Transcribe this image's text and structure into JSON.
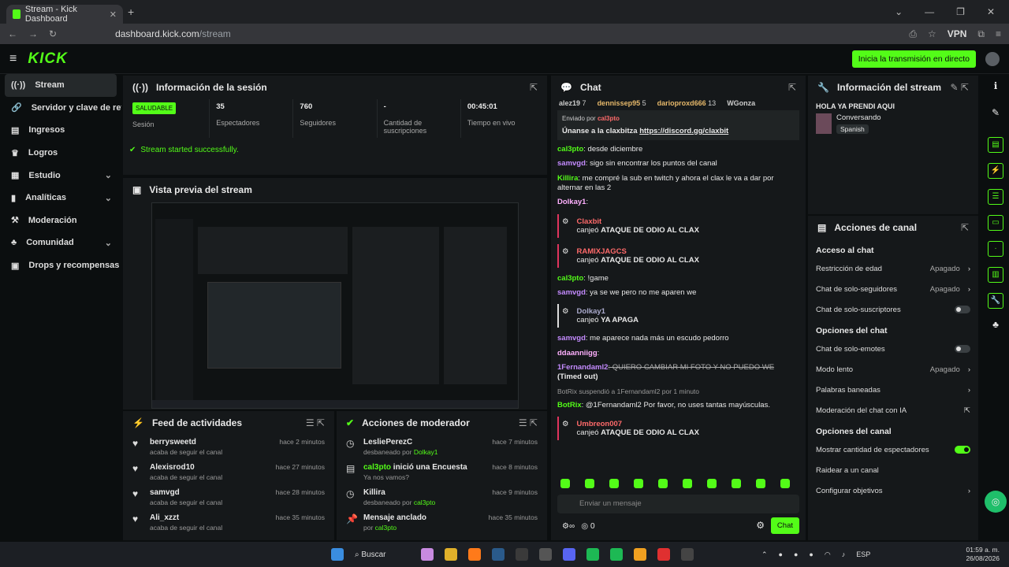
{
  "browser": {
    "tab_title": "Stream - Kick Dashboard",
    "url_host": "dashboard.kick.com",
    "url_path": "/stream",
    "vpn": "VPN"
  },
  "header": {
    "logo": "KICK",
    "go_live": "Inicia la transmisión en directo"
  },
  "sidebar": {
    "items": [
      {
        "label": "Stream"
      },
      {
        "label": "Servidor y clave de retransmisión"
      },
      {
        "label": "Ingresos"
      },
      {
        "label": "Logros"
      },
      {
        "label": "Estudio"
      },
      {
        "label": "Analíticas"
      },
      {
        "label": "Moderación"
      },
      {
        "label": "Comunidad"
      },
      {
        "label": "Drops y recompensas"
      }
    ]
  },
  "session": {
    "title": "Información de la sesión",
    "stats": [
      {
        "value": "SALUDABLE",
        "label": "Sesión"
      },
      {
        "value": "35",
        "label": "Espectadores"
      },
      {
        "value": "760",
        "label": "Seguidores"
      },
      {
        "value": "-",
        "label": "Cantidad de suscripciones"
      },
      {
        "value": "00:45:01",
        "label": "Tiempo en vivo"
      }
    ],
    "status": "Stream started successfully."
  },
  "preview": {
    "title": "Vista previa del stream"
  },
  "feed": {
    "title": "Feed de actividades",
    "items": [
      {
        "name": "berrysweetd",
        "sub": "acaba de seguir el canal",
        "time": "hace 2 minutos"
      },
      {
        "name": "Alexisrod10",
        "sub": "acaba de seguir el canal",
        "time": "hace 27 minutos"
      },
      {
        "name": "samvgd",
        "sub": "acaba de seguir el canal",
        "time": "hace 28 minutos"
      },
      {
        "name": "Ali_xzzt",
        "sub": "acaba de seguir el canal",
        "time": "hace 35 minutos"
      }
    ]
  },
  "mod": {
    "title": "Acciones de moderador",
    "items": [
      {
        "name": "LesliePerezC",
        "sub": "desbaneado por",
        "by": "Dolkay1",
        "time": "hace 7 minutos"
      },
      {
        "name": "cal3pto",
        "name2": " inició una Encuesta",
        "sub": "Ya nos vamos?",
        "time": "hace 8 minutos"
      },
      {
        "name": "Killira",
        "sub": "desbaneado por",
        "by": "cal3pto",
        "time": "hace 9 minutos"
      },
      {
        "name": "Mensaje anclado",
        "sub": "por",
        "by": "cal3pto",
        "time": "hace 35 minutos"
      }
    ]
  },
  "chat": {
    "title": "Chat",
    "top_users": [
      {
        "name": "alez19",
        "count": "7"
      },
      {
        "name": "dennissep95",
        "count": "5"
      },
      {
        "name": "darioproxd666",
        "count": "13"
      },
      {
        "name": "WGonza",
        "count": ""
      }
    ],
    "pinned_by": "Enviado por",
    "pinned_user": "cal3pto",
    "pinned_text": "Únanse a la claxbitza",
    "pinned_link": "https://discord.gg/claxbit",
    "messages": [
      {
        "user": "cal3pto",
        "text": ": desde diciembre"
      },
      {
        "user": "samvgd",
        "text": ": sigo sin encontrar los puntos del canal"
      },
      {
        "user": "Killira",
        "text": ": me compré la sub en twitch y ahora el clax le va a dar por alternar en las 2"
      },
      {
        "user": "Dolkay1",
        "text": ":"
      }
    ],
    "sys1_user": "Claxbit",
    "sys1_text": "canjeó",
    "sys1_reward": "ATAQUE DE ODIO AL CLAX",
    "sys2_user": "RAMIXJAGCS",
    "sys2_text": "canjeó",
    "sys2_reward": "ATAQUE DE ODIO AL CLAX",
    "msg5_user": "cal3pto",
    "msg5_text": ": !game",
    "msg6_user": "samvgd",
    "msg6_text": ": ya se we pero no me aparen we",
    "sys3_user": "Dolkay1",
    "sys3_text": "canjeó",
    "sys3_reward": "YA APAGA",
    "msg7_user": "samvgd",
    "msg7_text": ": me aparece nada más un escudo pedorro",
    "msg8_user": "ddaanniigg",
    "msg9_user": "1Fernandaml2",
    "msg9_text": ": QUIERO CAMBIAR MI FOTO Y NO PUEDO WE",
    "msg9_tag": "(Timed out)",
    "ban_text": "BotRix suspendió a 1Fernandaml2 por 1 minuto",
    "msg10_user": "BotRix",
    "msg10_text": ": @1Fernandaml2 Por favor, no uses tantas mayúsculas.",
    "sys4_user": "Umbreon007",
    "sys4_text": "canjeó",
    "sys4_reward": "ATAQUE DE ODIO AL CLAX",
    "input_placeholder": "Enviar un mensaje",
    "points": "0",
    "send": "Chat"
  },
  "streaminfo": {
    "title": "Información del stream",
    "stream_title": "HOLA YA PRENDI AQUI",
    "category": "Conversando",
    "lang": "Spanish"
  },
  "actions": {
    "title": "Acciones de canal",
    "sec1": "Acceso al chat",
    "r1": "Restricción de edad",
    "r1v": "Apagado",
    "r2": "Chat de solo-seguidores",
    "r2v": "Apagado",
    "r3": "Chat de solo-suscriptores",
    "sec2": "Opciones del chat",
    "r4": "Chat de solo-emotes",
    "r5": "Modo lento",
    "r5v": "Apagado",
    "r6": "Palabras baneadas",
    "r7": "Moderación del chat con IA",
    "sec3": "Opciones del canal",
    "r8": "Mostrar cantidad de espectadores",
    "r9": "Raidear a un canal",
    "r10": "Configurar objetivos"
  },
  "taskbar": {
    "search": "Buscar",
    "lang": "ESP",
    "time": "01:59 a. m.",
    "date": "26/08/2026"
  },
  "colors": {
    "accent": "#53fc18",
    "bg": "#0b0e0f",
    "panel": "#15181a"
  }
}
